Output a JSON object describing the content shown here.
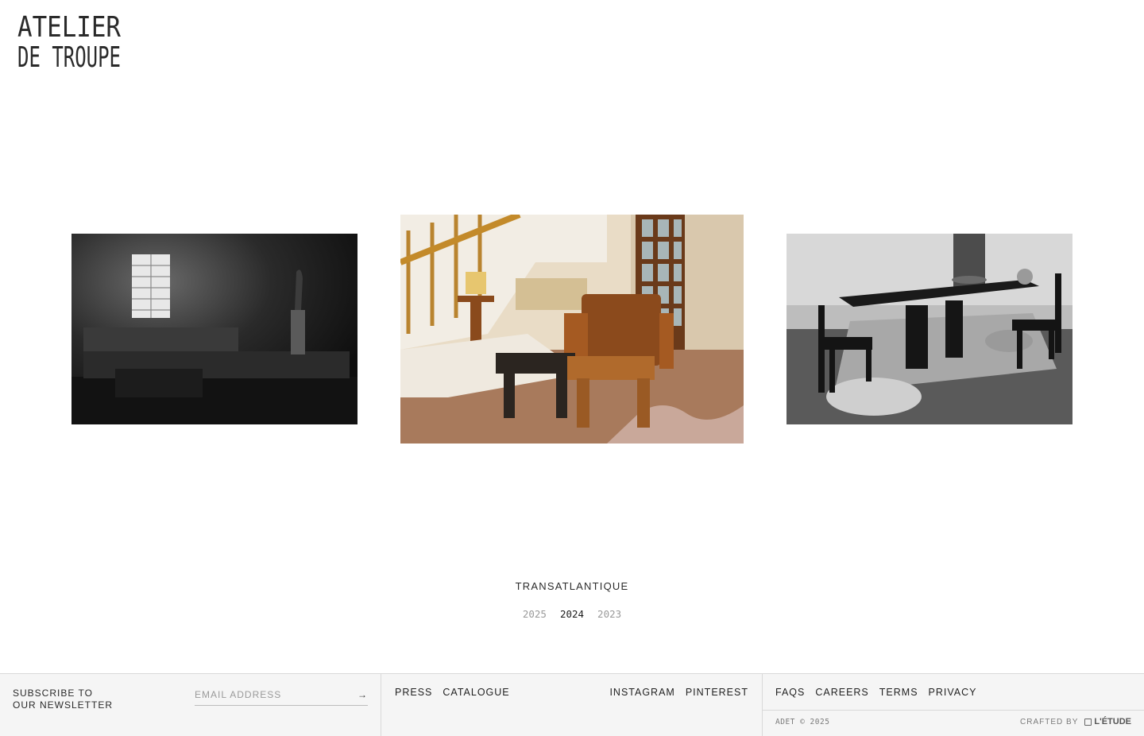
{
  "brand": {
    "logo_line1": "ATELIER",
    "logo_line2": "DE TROUPE"
  },
  "gallery": [
    {
      "alt": "dark room sofa",
      "icon": "sofa-photo"
    },
    {
      "alt": "staircase armchair",
      "icon": "armchair-photo"
    },
    {
      "alt": "dining table chairs",
      "icon": "dining-photo"
    }
  ],
  "collection": {
    "name": "TRANSATLANTIQUE",
    "years": [
      "2025",
      "2024",
      "2023"
    ],
    "active_year": "2024"
  },
  "footer": {
    "newsletter_line1": "SUBSCRIBE TO",
    "newsletter_line2": "OUR NEWSLETTER",
    "email_placeholder": "EMAIL ADDRESS",
    "submit_icon": "→",
    "nav_left": [
      "PRESS",
      "CATALOGUE"
    ],
    "nav_right": [
      "INSTAGRAM",
      "PINTEREST"
    ],
    "legal": [
      "FAQS",
      "CAREERS",
      "TERMS",
      "PRIVACY"
    ],
    "copyright": "ADET © 2025",
    "crafted_label": "CRAFTED BY",
    "studio": "L'ÉTUDE"
  },
  "colors": {
    "text": "#222222",
    "muted": "#9a9a9a",
    "footer_bg": "#f5f5f5",
    "border": "#d9d9d9"
  }
}
